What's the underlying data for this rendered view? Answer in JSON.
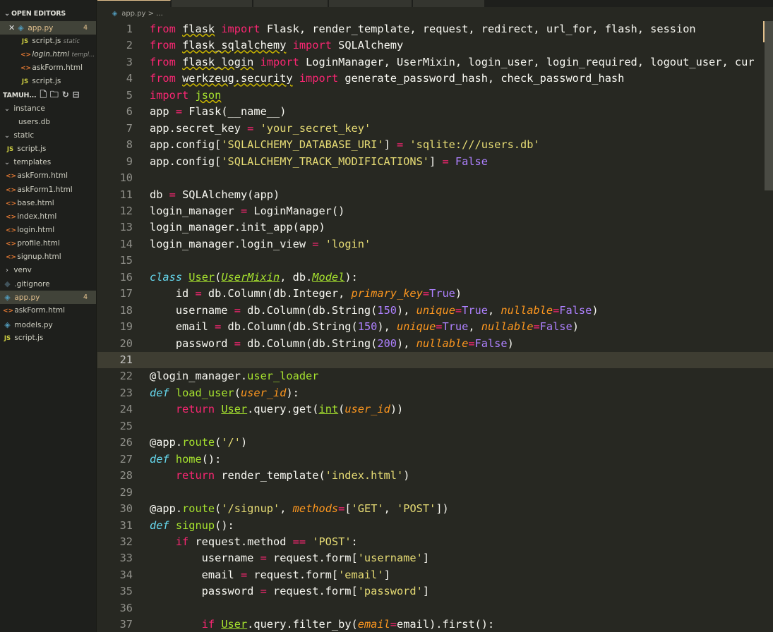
{
  "sidebar": {
    "open_editors_title": "OPEN EDITORS",
    "open_editors": [
      {
        "name": "app.py",
        "badge": "4"
      },
      {
        "name": "script.js",
        "desc": "static"
      },
      {
        "name": "login.html",
        "desc": "templ..."
      },
      {
        "name": "askForm.html"
      },
      {
        "name": "script.js"
      }
    ],
    "workspace_title": "TAMUH...",
    "tree": [
      "instance",
      "users.db",
      "static",
      "script.js",
      "templates",
      "askForm.html",
      "askForm1.html",
      "base.html",
      "index.html",
      "login.html",
      "profile.html",
      "signup.html",
      "venv",
      ".gitignore",
      "app.py",
      "askForm.html",
      "models.py",
      "script.js"
    ],
    "app_badge": "4"
  },
  "breadcrumb": {
    "file": "app.py",
    "sep": ">",
    "more": "..."
  },
  "icons": {
    "js_label": "JS",
    "html_glyph": "<>",
    "py_glyph": "◈",
    "git_glyph": "◆",
    "close_glyph": "✕",
    "chevron_down": "⌄",
    "chevron_right": "›"
  },
  "editor": {
    "cursor_line": 21,
    "lines": [
      [
        [
          "kw",
          "from"
        ],
        [
          "",
          ""
        ],
        [
          " ",
          " "
        ],
        [
          "sq",
          "flask"
        ],
        [
          "",
          " "
        ],
        [
          "kw",
          "import"
        ],
        [
          "",
          " Flask, render_template, request, redirect, url_for, flash, session"
        ]
      ],
      [
        [
          "kw",
          "from"
        ],
        [
          "",
          " "
        ],
        [
          "sq",
          "flask_sqlalchemy"
        ],
        [
          "",
          " "
        ],
        [
          "kw",
          "import"
        ],
        [
          "",
          " SQLAlchemy"
        ]
      ],
      [
        [
          "kw",
          "from"
        ],
        [
          "",
          " "
        ],
        [
          "sq",
          "flask_login"
        ],
        [
          "",
          " "
        ],
        [
          "kw",
          "import"
        ],
        [
          "",
          " LoginManager, UserMixin, login_user, login_required, logout_user, cur"
        ]
      ],
      [
        [
          "kw",
          "from"
        ],
        [
          "",
          " "
        ],
        [
          "sq",
          "werkzeug.security"
        ],
        [
          "",
          " "
        ],
        [
          "kw",
          "import"
        ],
        [
          "",
          " generate_password_hash, check_password_hash"
        ]
      ],
      [
        [
          "kw",
          "import"
        ],
        [
          "",
          " "
        ],
        [
          "sqj",
          "json"
        ]
      ],
      [
        [
          "",
          "app "
        ],
        [
          "kw",
          "="
        ],
        [
          "",
          " Flask("
        ],
        [
          "",
          "__name__"
        ],
        [
          "",
          ")"
        ]
      ],
      [
        [
          "",
          "app.secret_key "
        ],
        [
          "kw",
          "="
        ],
        [
          "",
          " "
        ],
        [
          "str",
          "'your_secret_key'"
        ]
      ],
      [
        [
          "",
          "app.config["
        ],
        [
          "str",
          "'SQLALCHEMY_DATABASE_URI'"
        ],
        [
          "",
          "] "
        ],
        [
          "kw",
          "="
        ],
        [
          "",
          " "
        ],
        [
          "str",
          "'sqlite:///users.db'"
        ]
      ],
      [
        [
          "",
          "app.config["
        ],
        [
          "str",
          "'SQLALCHEMY_TRACK_MODIFICATIONS'"
        ],
        [
          "",
          "] "
        ],
        [
          "kw",
          "="
        ],
        [
          "",
          " "
        ],
        [
          "con",
          "False"
        ]
      ],
      [],
      [
        [
          "",
          "db "
        ],
        [
          "kw",
          "="
        ],
        [
          "",
          " SQLAlchemy(app)"
        ]
      ],
      [
        [
          "",
          "login_manager "
        ],
        [
          "kw",
          "="
        ],
        [
          "",
          " LoginManager()"
        ]
      ],
      [
        [
          "",
          "login_manager.init_app(app)"
        ]
      ],
      [
        [
          "",
          "login_manager.login_view "
        ],
        [
          "kw",
          "="
        ],
        [
          "",
          " "
        ],
        [
          "str",
          "'login'"
        ]
      ],
      [],
      [
        [
          "bi",
          "class"
        ],
        [
          "",
          " "
        ],
        [
          "cls",
          "User"
        ],
        [
          "",
          "("
        ],
        [
          "clsi",
          "UserMixin"
        ],
        [
          "",
          ", db."
        ],
        [
          "clsi",
          "Model"
        ],
        [
          "",
          "):"
        ]
      ],
      [
        [
          "",
          "    id "
        ],
        [
          "kw",
          "="
        ],
        [
          "",
          " db.Column(db.Integer, "
        ],
        [
          "param",
          "primary_key"
        ],
        [
          "kw",
          "="
        ],
        [
          "con",
          "True"
        ],
        [
          "",
          ")"
        ]
      ],
      [
        [
          "",
          "    username "
        ],
        [
          "kw",
          "="
        ],
        [
          "",
          " db.Column(db.String("
        ],
        [
          "num",
          "150"
        ],
        [
          "",
          "), "
        ],
        [
          "param",
          "unique"
        ],
        [
          "kw",
          "="
        ],
        [
          "con",
          "True"
        ],
        [
          "",
          ", "
        ],
        [
          "param",
          "nullable"
        ],
        [
          "kw",
          "="
        ],
        [
          "con",
          "False"
        ],
        [
          "",
          ")"
        ]
      ],
      [
        [
          "",
          "    email "
        ],
        [
          "kw",
          "="
        ],
        [
          "",
          " db.Column(db.String("
        ],
        [
          "num",
          "150"
        ],
        [
          "",
          "), "
        ],
        [
          "param",
          "unique"
        ],
        [
          "kw",
          "="
        ],
        [
          "con",
          "True"
        ],
        [
          "",
          ", "
        ],
        [
          "param",
          "nullable"
        ],
        [
          "kw",
          "="
        ],
        [
          "con",
          "False"
        ],
        [
          "",
          ")"
        ]
      ],
      [
        [
          "",
          "    password "
        ],
        [
          "kw",
          "="
        ],
        [
          "",
          " db.Column(db.String("
        ],
        [
          "num",
          "200"
        ],
        [
          "",
          "), "
        ],
        [
          "param",
          "nullable"
        ],
        [
          "kw",
          "="
        ],
        [
          "con",
          "False"
        ],
        [
          "",
          ")"
        ]
      ],
      [],
      [
        [
          "",
          "@login_manager."
        ],
        [
          "dec",
          "user_loader"
        ]
      ],
      [
        [
          "bi",
          "def"
        ],
        [
          "",
          " "
        ],
        [
          "fn",
          "load_user"
        ],
        [
          "",
          "("
        ],
        [
          "param",
          "user_id"
        ],
        [
          "",
          "):"
        ]
      ],
      [
        [
          "",
          "    "
        ],
        [
          "kw",
          "return"
        ],
        [
          "",
          " "
        ],
        [
          "clsu",
          "User"
        ],
        [
          "",
          ".query.get("
        ],
        [
          "clsu",
          "int"
        ],
        [
          "",
          "("
        ],
        [
          "param",
          "user_id"
        ],
        [
          "",
          "))"
        ]
      ],
      [],
      [
        [
          "",
          "@app."
        ],
        [
          "dec",
          "route"
        ],
        [
          "",
          "("
        ],
        [
          "str",
          "'/'"
        ],
        [
          "",
          ")"
        ]
      ],
      [
        [
          "bi",
          "def"
        ],
        [
          "",
          " "
        ],
        [
          "fn",
          "home"
        ],
        [
          "",
          "():"
        ]
      ],
      [
        [
          "",
          "    "
        ],
        [
          "kw",
          "return"
        ],
        [
          "",
          " render_template("
        ],
        [
          "str",
          "'index.html'"
        ],
        [
          "",
          ")"
        ]
      ],
      [],
      [
        [
          "",
          "@app."
        ],
        [
          "dec",
          "route"
        ],
        [
          "",
          "("
        ],
        [
          "str",
          "'/signup'"
        ],
        [
          "",
          ", "
        ],
        [
          "param",
          "methods"
        ],
        [
          "kw",
          "="
        ],
        [
          "",
          "["
        ],
        [
          "str",
          "'GET'"
        ],
        [
          "",
          ", "
        ],
        [
          "str",
          "'POST'"
        ],
        [
          "",
          "])"
        ]
      ],
      [
        [
          "bi",
          "def"
        ],
        [
          "",
          " "
        ],
        [
          "fn",
          "signup"
        ],
        [
          "",
          "():"
        ]
      ],
      [
        [
          "",
          "    "
        ],
        [
          "kw",
          "if"
        ],
        [
          "",
          " request.method "
        ],
        [
          "kw",
          "=="
        ],
        [
          "",
          " "
        ],
        [
          "str",
          "'POST'"
        ],
        [
          "",
          ":"
        ]
      ],
      [
        [
          "",
          "        username "
        ],
        [
          "kw",
          "="
        ],
        [
          "",
          " request.form["
        ],
        [
          "str",
          "'username'"
        ],
        [
          "",
          "]"
        ]
      ],
      [
        [
          "",
          "        email "
        ],
        [
          "kw",
          "="
        ],
        [
          "",
          " request.form["
        ],
        [
          "str",
          "'email'"
        ],
        [
          "",
          "]"
        ]
      ],
      [
        [
          "",
          "        password "
        ],
        [
          "kw",
          "="
        ],
        [
          "",
          " request.form["
        ],
        [
          "str",
          "'password'"
        ],
        [
          "",
          "]"
        ]
      ],
      [],
      [
        [
          "",
          "        "
        ],
        [
          "kw",
          "if"
        ],
        [
          "",
          " "
        ],
        [
          "clsu",
          "User"
        ],
        [
          "",
          ".query.filter_by("
        ],
        [
          "param",
          "email"
        ],
        [
          "kw",
          "="
        ],
        [
          "",
          "email).first():"
        ]
      ]
    ]
  }
}
